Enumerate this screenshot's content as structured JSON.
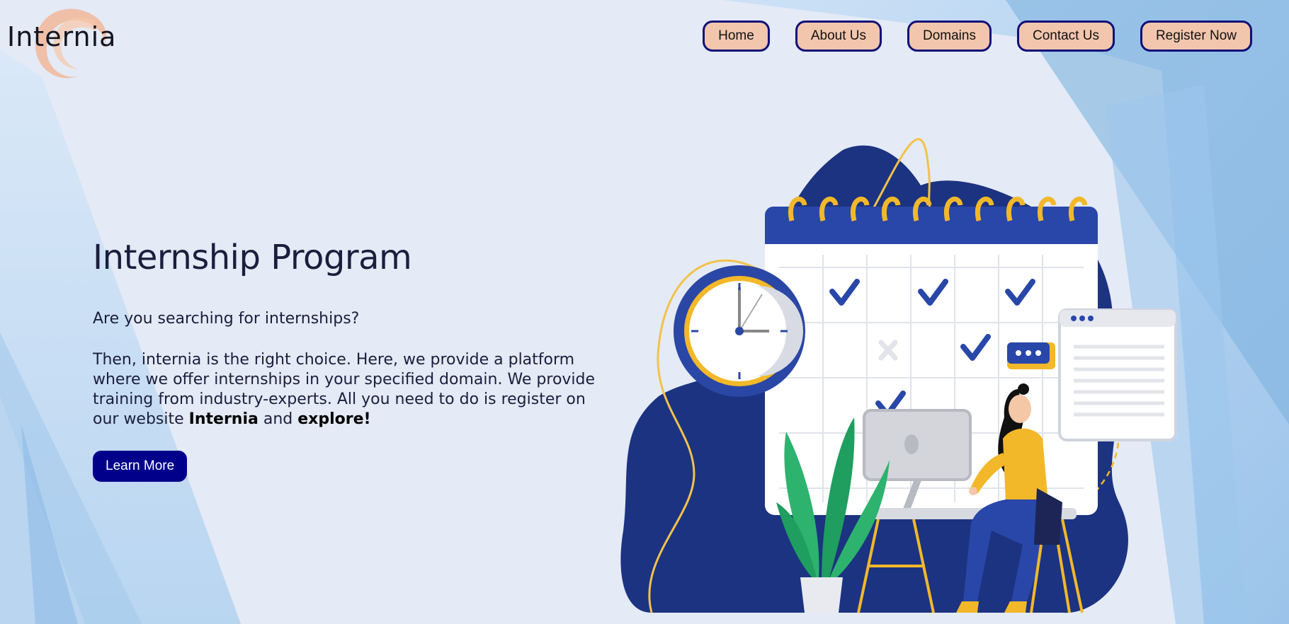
{
  "brand": {
    "name": "Internia",
    "swirl_color": "#f4b08c"
  },
  "nav": {
    "items": [
      {
        "label": "Home"
      },
      {
        "label": "About Us"
      },
      {
        "label": "Domains"
      },
      {
        "label": "Contact Us"
      },
      {
        "label": "Register Now"
      }
    ],
    "button_bg": "#f2c6ad",
    "button_border": "#0f0f7a"
  },
  "hero": {
    "title": "Internship Program",
    "question": "Are you searching for internships?",
    "body_intro": "Then, internia is the right choice. Here, we provide a platform where we offer internships in your specified domain. We provide training from industry-experts. All you need to do is register on our website ",
    "body_brand": "Internia",
    "body_and": " and ",
    "body_cta": "explore!",
    "learn_more_label": "Learn More",
    "learn_more_bg": "#00008b"
  },
  "illustration": {
    "icons": [
      "calendar-icon",
      "clock-icon",
      "chat-bubble-icon",
      "document-window-icon",
      "computer-monitor-icon",
      "plant-icon",
      "person-at-desk-icon"
    ],
    "primary_color": "#1e3a8a",
    "accent_color": "#f2b829",
    "green_color": "#2db36d"
  }
}
